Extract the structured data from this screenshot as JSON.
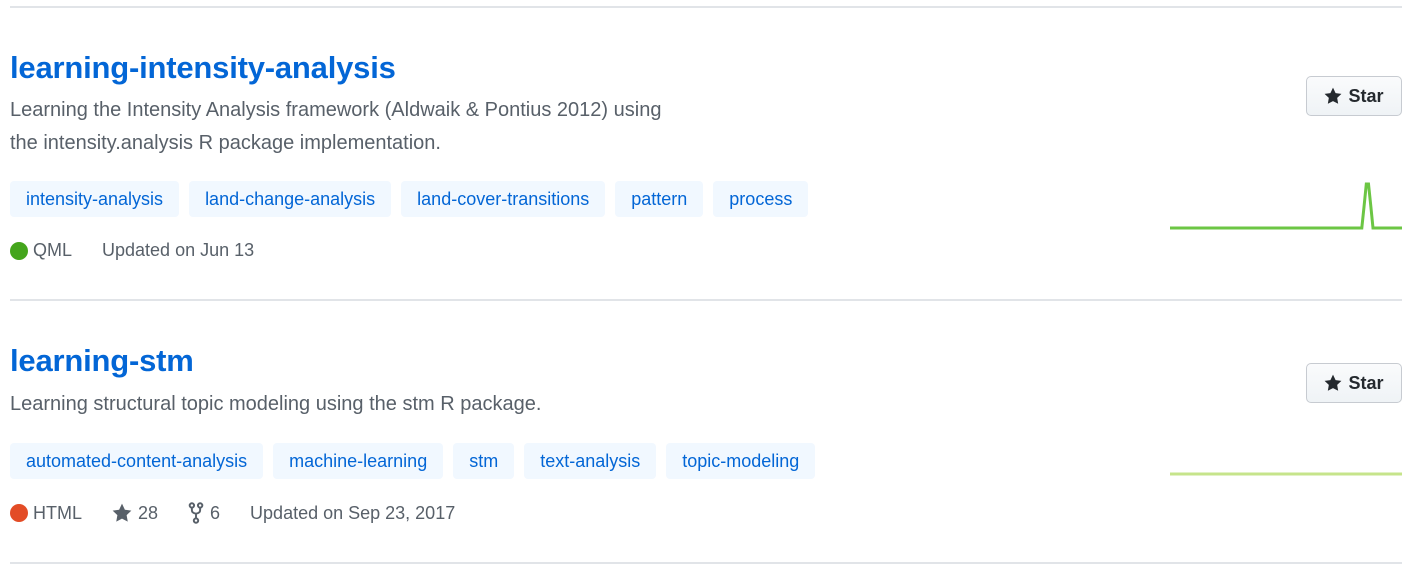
{
  "repos": [
    {
      "name": "learning-intensity-analysis",
      "description_line1": "Learning the Intensity Analysis framework (Aldwaik & Pontius 2012) using",
      "description_line2": "the intensity.analysis R package implementation.",
      "topics": [
        "intensity-analysis",
        "land-change-analysis",
        "land-cover-transitions",
        "pattern",
        "process"
      ],
      "language": "QML",
      "language_color": "#44a51c",
      "updated": "Updated on Jun 13",
      "star_label": "Star",
      "activity": [
        0,
        0,
        0,
        0,
        0,
        0,
        0,
        0,
        0,
        0,
        0,
        0,
        0,
        0,
        0,
        0,
        0,
        0,
        0,
        0,
        0,
        0,
        0,
        0,
        0,
        0,
        0,
        0,
        0,
        0,
        0,
        0,
        0,
        0,
        0,
        0,
        0,
        0,
        0,
        0,
        0,
        0,
        0,
        0,
        0,
        0,
        0,
        0,
        0,
        0,
        0,
        0,
        0,
        0,
        0,
        0,
        0,
        0,
        0,
        0,
        0,
        0,
        0,
        0,
        0,
        0,
        0,
        0,
        0,
        0,
        0,
        0,
        0,
        0,
        0,
        0,
        0,
        0,
        0,
        0,
        0,
        0,
        0,
        0,
        0,
        0,
        0,
        1,
        2,
        2,
        1,
        0,
        0,
        0,
        0,
        0,
        0,
        0,
        0,
        0,
        0,
        0,
        0,
        0,
        0
      ],
      "activity_color": "#6cc644"
    },
    {
      "name": "learning-stm",
      "description_line1": "Learning structural topic modeling using the stm R package.",
      "topics": [
        "automated-content-analysis",
        "machine-learning",
        "stm",
        "text-analysis",
        "topic-modeling"
      ],
      "language": "HTML",
      "language_color": "#e34c26",
      "stars": "28",
      "forks": "6",
      "updated": "Updated on Sep 23, 2017",
      "star_label": "Star",
      "activity": [
        0,
        0,
        0,
        0,
        0,
        0,
        0,
        0,
        0,
        0,
        0,
        0,
        0,
        0,
        0,
        0,
        0,
        0,
        0,
        0,
        0,
        0,
        0,
        0,
        0,
        0,
        0,
        0,
        0,
        0,
        0,
        0,
        0,
        0,
        0,
        0,
        0,
        0,
        0,
        0,
        0,
        0,
        0,
        0,
        0,
        0,
        0,
        0,
        0,
        0,
        0,
        0,
        0,
        0,
        0,
        0,
        0,
        0,
        0,
        0,
        0,
        0,
        0,
        0,
        0,
        0,
        0,
        0,
        0,
        0,
        0,
        0,
        0,
        0,
        0,
        0,
        0,
        0,
        0,
        0,
        0,
        0,
        0,
        0,
        0,
        0,
        0,
        0,
        0,
        0,
        0,
        0,
        0,
        0,
        0,
        0,
        0,
        0,
        0,
        0,
        0,
        0,
        0,
        0,
        0
      ],
      "activity_color": "#c6e48b"
    }
  ]
}
